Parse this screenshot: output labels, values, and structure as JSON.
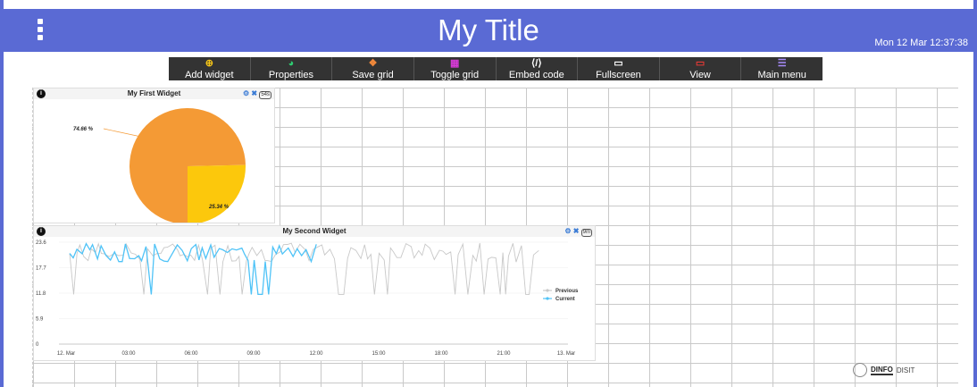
{
  "header": {
    "title": "My Title",
    "datetime": "Mon 12 Mar 12:37:38",
    "menu_icon": "vertical-dots-icon",
    "color": "#5a6ad4"
  },
  "toolbar": {
    "items": [
      {
        "label": "Add widget",
        "icon": "plus-circle-icon",
        "color": "#f5c518"
      },
      {
        "label": "Properties",
        "icon": "dashboard-gauge-icon",
        "color": "#2ecc71"
      },
      {
        "label": "Save grid",
        "icon": "cubes-icon",
        "color": "#f0883a"
      },
      {
        "label": "Toggle grid",
        "icon": "grid-icon",
        "color": "#d63ad6"
      },
      {
        "label": "Embed code",
        "icon": "code-file-icon",
        "color": "#ffffff"
      },
      {
        "label": "Fullscreen",
        "icon": "window-icon",
        "color": "#ffffff"
      },
      {
        "label": "View",
        "icon": "monitor-icon",
        "color": "#e53935"
      },
      {
        "label": "Main menu",
        "icon": "bars-icon",
        "color": "#a78bfa"
      }
    ]
  },
  "widget1": {
    "title": "My First Widget",
    "badge": "54s",
    "chart_data": {
      "type": "pie",
      "values": [
        74.66,
        25.34
      ],
      "labels": [
        "74.66 %",
        "25.34 %"
      ],
      "colors": [
        "#f49a35",
        "#fcc80c"
      ]
    }
  },
  "widget2": {
    "title": "My Second Widget",
    "badge": "9m",
    "chart_data": {
      "type": "line",
      "yticks": [
        "23.6",
        "17.7",
        "11.8",
        "5.9",
        "0"
      ],
      "ylim": [
        0,
        23.6
      ],
      "xticks": [
        "12. Mar",
        "03:00",
        "06:00",
        "09:00",
        "12:00",
        "15:00",
        "18:00",
        "21:00",
        "13. Mar"
      ],
      "series": [
        {
          "name": "Previous",
          "color": "#c8c8c8"
        },
        {
          "name": "Current",
          "color": "#4fc3f7"
        }
      ]
    }
  },
  "footer": {
    "logo1": "DINFO",
    "logo2": "DISIT"
  }
}
